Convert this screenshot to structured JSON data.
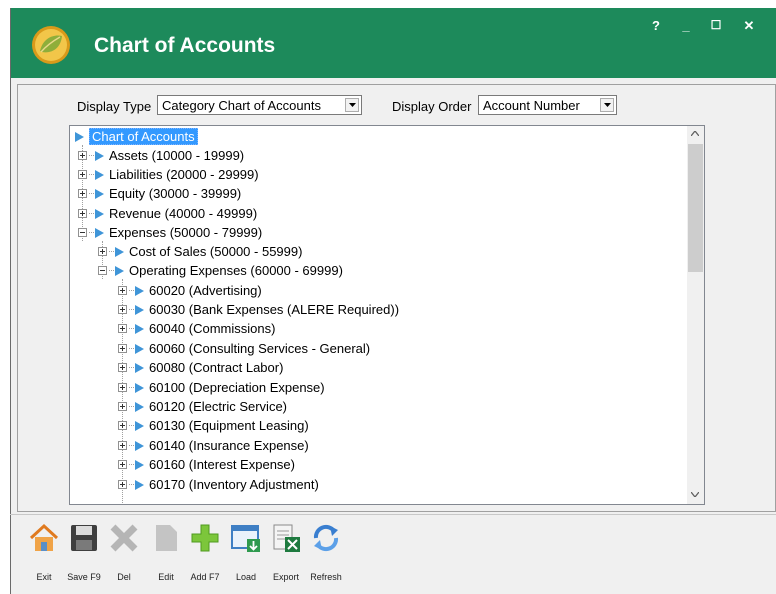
{
  "window": {
    "title": "Chart of Accounts",
    "controls": {
      "help": "?",
      "minimize": "_",
      "maximize": "☐",
      "close": "✕"
    }
  },
  "filters": {
    "display_type_label": "Display Type",
    "display_type_value": "Category Chart of Accounts",
    "display_order_label": "Display Order",
    "display_order_value": "Account Number"
  },
  "tree": {
    "root": "Chart of Accounts",
    "top": [
      {
        "label": "Assets (10000 - 19999)",
        "expanded": false
      },
      {
        "label": "Liabilities (20000 - 29999)",
        "expanded": false
      },
      {
        "label": "Equity (30000 - 39999)",
        "expanded": false
      },
      {
        "label": "Revenue (40000 - 49999)",
        "expanded": false
      },
      {
        "label": "Expenses (50000 - 79999)",
        "expanded": true
      }
    ],
    "expense_children": [
      {
        "label": "Cost of Sales (50000 - 55999)",
        "expanded": false
      },
      {
        "label": "Operating Expenses (60000 - 69999)",
        "expanded": true
      }
    ],
    "operating_children": [
      "60020 (Advertising)",
      "60030 (Bank Expenses (ALERE Required))",
      "60040 (Commissions)",
      "60060 (Consulting Services - General)",
      "60080 (Contract Labor)",
      "60100 (Depreciation Expense)",
      "60120 (Electric Service)",
      "60130 (Equipment Leasing)",
      "60140 (Insurance Expense)",
      "60160 (Interest Expense)",
      "60170 (Inventory Adjustment)"
    ]
  },
  "toolbar": {
    "exit": "Exit",
    "save": "Save F9",
    "del": "Del",
    "edit": "Edit",
    "add": "Add F7",
    "load": "Load",
    "export": "Export",
    "refresh": "Refresh"
  },
  "colors": {
    "titlebar": "#1d8a5b",
    "selection": "#3399ff",
    "node_triangle": "#3f95d8"
  }
}
